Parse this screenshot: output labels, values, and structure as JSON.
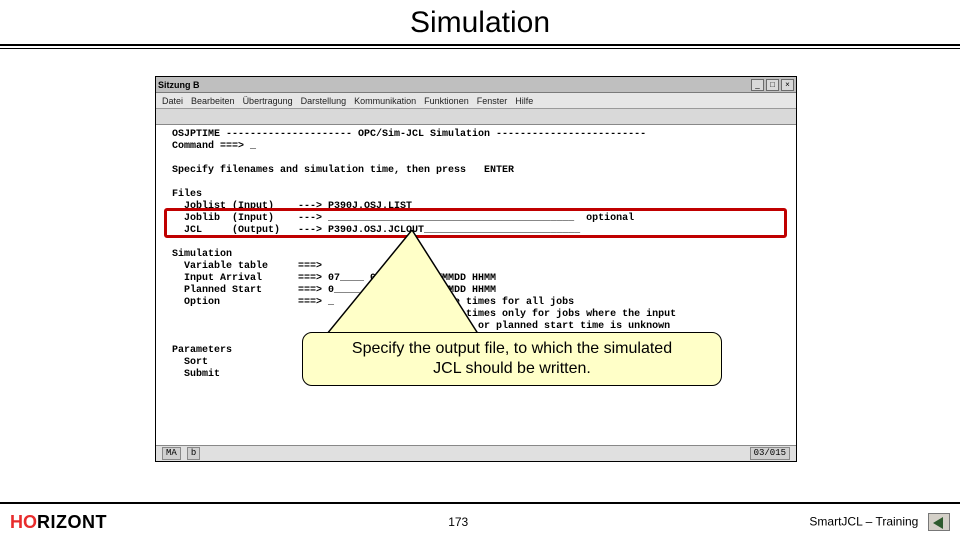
{
  "title": "Simulation",
  "terminal": {
    "title_prefix": "Sitzung B",
    "menu": {
      "m1": "Datei",
      "m2": "Bearbeiten",
      "m3": "Übertragung",
      "m4": "Darstellung",
      "m5": "Kommunikation",
      "m6": "Funktionen",
      "m7": "Fenster",
      "m8": "Hilfe"
    },
    "winbtn_min": "_",
    "winbtn_max": "□",
    "winbtn_close": "×",
    "lines": {
      "l01": " OSJPTIME --------------------- OPC/Sim-JCL Simulation -------------------------",
      "l02": " Command ===> _",
      "l03": " ",
      "l04": " Specify filenames and simulation time, then press   ENTER",
      "l05": " ",
      "l06": " Files",
      "l07": "   Joblist (Input)    ---> P390J.OSJ.LIST____________________________",
      "l08": "   Joblib  (Input)    ---> _________________________________________  optional",
      "l09": "   JCL     (Output)   ---> P390J.OSJ.JCLOUT__________________________",
      "l10": " ",
      "l11": " Simulation",
      "l12": "   Variable table     ===> ",
      "l13": "   Input Arrival      ===> 07____ 0001      YYMMDD HHMM",
      "l14": "   Planned Start      ===> 0_____ 0001      YYMMDD HHMM",
      "l15": "   Option             ===> _                A Use times for all jobs",
      "l16": "                                            U Use times only for jobs where the input",
      "l17": "                                            arrival or planned start time is unknown",
      "l18": " ",
      "l19": " Parameters",
      "l20": "   Sort               ",
      "l21": "   Submit             "
    },
    "status_left_1": "MA",
    "status_left_2": "b",
    "status_right": "03/015"
  },
  "callout": {
    "line1": "Specify the output file, to which the simulated",
    "line2": "JCL should be written."
  },
  "footer": {
    "logo_h": "H",
    "logo_o": "O",
    "logo_rest": "RIZONT",
    "page": "173",
    "course": "SmartJCL – Training"
  }
}
